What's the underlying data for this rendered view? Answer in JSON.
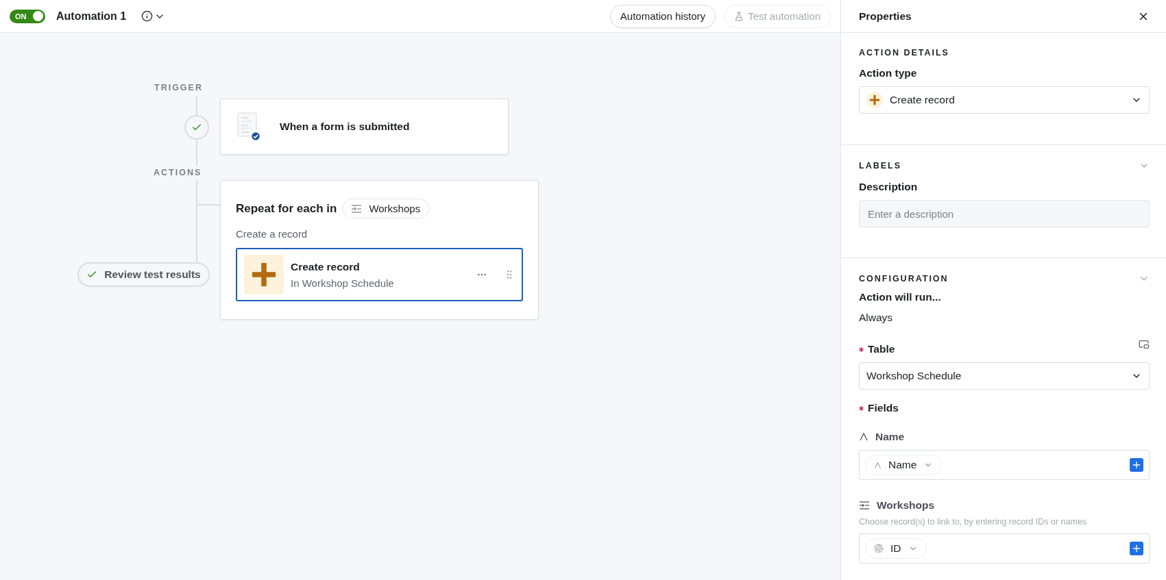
{
  "toolbar": {
    "toggle": {
      "label": "ON",
      "on": true
    },
    "title": "Automation 1",
    "buttons": [
      {
        "label": "Automation history",
        "disabled": false
      },
      {
        "label": "Test automation",
        "disabled": true
      }
    ]
  },
  "flow": {
    "trigger_label": "TRIGGER",
    "trigger": {
      "title": "When a form is submitted",
      "done": true
    },
    "actions_label": "ACTIONS",
    "repeat": {
      "prefix": "Repeat for each in",
      "chip": "Workshops",
      "subtitle": "Create a record",
      "action": {
        "title": "Create record",
        "subtitle": "In Workshop Schedule",
        "selected": true
      }
    },
    "review_button": "Review test results"
  },
  "properties": {
    "title": "Properties",
    "action_details": {
      "heading": "ACTION DETAILS",
      "field_label": "Action type",
      "value": "Create record"
    },
    "labels": {
      "heading": "LABELS",
      "field_label": "Description",
      "placeholder": "Enter a description"
    },
    "configuration": {
      "heading": "CONFIGURATION",
      "run_label": "Action will run...",
      "run_value": "Always",
      "table": {
        "label": "Table",
        "required": true,
        "value": "Workshop Schedule"
      },
      "fields_heading": {
        "label": "Fields",
        "required": true
      },
      "fields": [
        {
          "kind": "text",
          "label": "Name",
          "token": "Name"
        },
        {
          "kind": "link",
          "label": "Workshops",
          "hint": "Choose record(s) to link to, by entering record IDs or names",
          "token": "ID"
        }
      ]
    }
  }
}
